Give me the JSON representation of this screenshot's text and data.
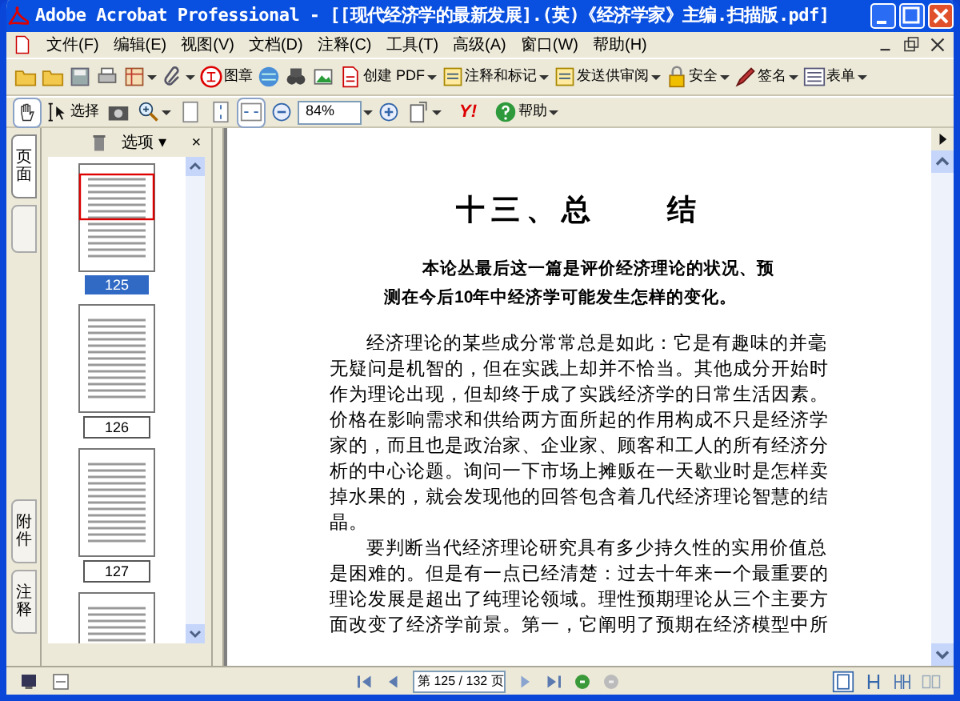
{
  "window": {
    "title": "Adobe Acrobat Professional - [[现代经济学的最新发展].(英)《经济学家》主编.扫描版.pdf]"
  },
  "menu": [
    "文件(F)",
    "编辑(E)",
    "视图(V)",
    "文档(D)",
    "注释(C)",
    "工具(T)",
    "高级(A)",
    "窗口(W)",
    "帮助(H)"
  ],
  "toolbar1": [
    {
      "kind": "button"
    },
    {
      "kind": "button"
    },
    {
      "kind": "button"
    },
    {
      "kind": "button"
    },
    {
      "kind": "button",
      "menu": true
    },
    {
      "kind": "button",
      "menu": true
    },
    {
      "kind": "button",
      "label": "图章"
    },
    {
      "kind": "button"
    },
    {
      "kind": "button"
    },
    {
      "kind": "button"
    },
    {
      "kind": "button",
      "label": "创建 PDF",
      "menu": true
    },
    {
      "kind": "button",
      "label": "注释和标记",
      "menu": true
    },
    {
      "kind": "button",
      "label": "发送供审阅",
      "menu": true
    },
    {
      "kind": "button",
      "label": "安全",
      "menu": true
    },
    {
      "kind": "button",
      "label": "签名",
      "menu": true
    },
    {
      "kind": "button",
      "label": "表单",
      "menu": true
    }
  ],
  "toolbar2": [
    {
      "kind": "button",
      "selected": true
    },
    {
      "kind": "button",
      "label": "选择",
      "selected": false
    },
    {
      "kind": "button",
      "selected": false
    },
    {
      "kind": "button",
      "menu": true,
      "selected": false
    },
    {
      "kind": "button",
      "selected": false
    },
    {
      "kind": "button",
      "selected": false
    },
    {
      "kind": "button",
      "selected": true
    },
    {
      "kind": "button",
      "selected": false
    },
    {
      "kind": "field",
      "value": "84%",
      "menu": true
    },
    {
      "kind": "button",
      "selected": false
    },
    {
      "kind": "button",
      "menu": true,
      "selected": false
    },
    {
      "kind": "text",
      "label": "Y!"
    },
    {
      "kind": "button",
      "label": "帮助",
      "menu": true,
      "selected": false
    }
  ],
  "side_tabs": [
    {
      "label": "页面",
      "selected": true
    },
    {
      "selected": false
    },
    {
      "label": "附件",
      "selected": false
    },
    {
      "label": "注释",
      "selected": false
    }
  ],
  "panel": {
    "options": "选项 ▾",
    "close": "×"
  },
  "thumbnails": [
    {
      "label": "125",
      "selected": true
    },
    {
      "label": "126",
      "selected": false
    },
    {
      "label": "127",
      "selected": false
    }
  ],
  "document": {
    "heading": "十三、总　　结",
    "abstract": [
      "本论丛最后这一篇是评价经济理论的状况、预",
      "测在今后10年中经济学可能发生怎样的变化。"
    ],
    "paragraphs": [
      [
        "经济理论的某些成分常常总是如此：它是有趣味的并毫",
        "无疑问是机智的，但在实践上却并不恰当。其他成分开始时",
        "作为理论出现，但却终于成了实践经济学的日常生活因素。",
        "价格在影响需求和供给两方面所起的作用构成不只是经济学",
        "家的，而且也是政治家、企业家、顾客和工人的所有经济分",
        "析的中心论题。询问一下市场上摊贩在一天歇业时是怎样卖",
        "掉水果的，就会发现他的回答包含着几代经济理论智慧的结",
        "晶。"
      ],
      [
        "要判断当代经济理论研究具有多少持久性的实用价值总",
        "是困难的。但是有一点已经清楚：过去十年来一个最重要的",
        "理论发展是超出了纯理论领域。理性预期理论从三个主要方",
        "面改变了经济学前景。第一，它阐明了预期在经济模型中所"
      ]
    ]
  },
  "status_bar": {
    "page_field": "第 125 / 132 页"
  }
}
